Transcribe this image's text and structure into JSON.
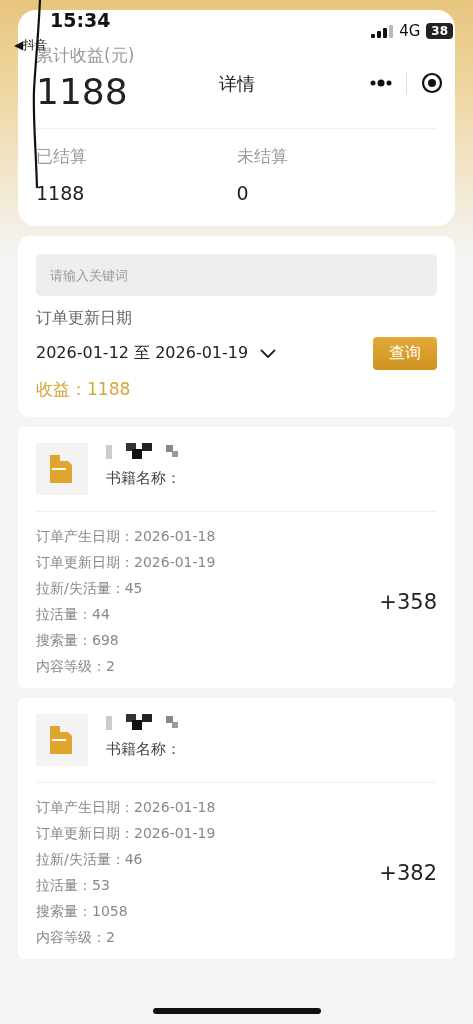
{
  "status_bar": {
    "time": "15:34",
    "back_label": "◀抖音",
    "network": "4G",
    "battery": "38"
  },
  "nav": {
    "title": "详情"
  },
  "summary": {
    "label": "累计收益(元)",
    "total": "1188",
    "settled_label": "已结算",
    "settled": "1188",
    "unsettled_label": "未结算",
    "unsettled": "0"
  },
  "filter": {
    "search_placeholder": "请输入关键词",
    "date_label": "订单更新日期",
    "date_range": "2026-01-12 至 2026-01-19",
    "query_button": "查询",
    "income": "收益：1188"
  },
  "orders": [
    {
      "book_label": "书籍名称：",
      "fields": [
        "订单产生日期：2026-01-18",
        "订单更新日期：2026-01-19",
        "拉新/失活量：45",
        "拉活量：44",
        "搜索量：698",
        "内容等级：2"
      ],
      "amount": "+358"
    },
    {
      "book_label": "书籍名称：",
      "fields": [
        "订单产生日期：2026-01-18",
        "订单更新日期：2026-01-19",
        "拉新/失活量：46",
        "拉活量：53",
        "搜索量：1058",
        "内容等级：2"
      ],
      "amount": "+382"
    }
  ]
}
